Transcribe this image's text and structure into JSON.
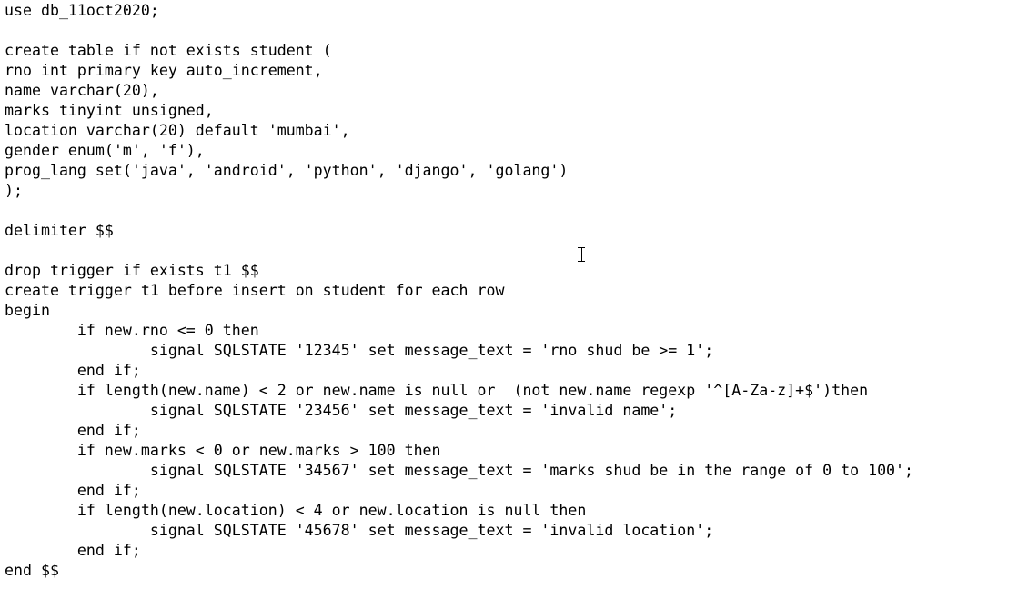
{
  "editor": {
    "lines": [
      "use db_11oct2020;",
      "",
      "create table if not exists student (",
      "rno int primary key auto_increment,",
      "name varchar(20),",
      "marks tinyint unsigned,",
      "location varchar(20) default 'mumbai',",
      "gender enum('m', 'f'),",
      "prog_lang set('java', 'android', 'python', 'django', 'golang')",
      ");",
      "",
      "delimiter $$",
      "",
      "drop trigger if exists t1 $$",
      "create trigger t1 before insert on student for each row",
      "begin",
      "        if new.rno <= 0 then",
      "                signal SQLSTATE '12345' set message_text = 'rno shud be >= 1';",
      "        end if;",
      "        if length(new.name) < 2 or new.name is null or  (not new.name regexp '^[A-Za-z]+$')then",
      "                signal SQLSTATE '23456' set message_text = 'invalid name';",
      "        end if;",
      "        if new.marks < 0 or new.marks > 100 then",
      "                signal SQLSTATE '34567' set message_text = 'marks shud be in the range of 0 to 100';",
      "        end if;",
      "        if length(new.location) < 4 or new.location is null then",
      "                signal SQLSTATE '45678' set message_text = 'invalid location';",
      "        end if;",
      "end $$"
    ]
  }
}
